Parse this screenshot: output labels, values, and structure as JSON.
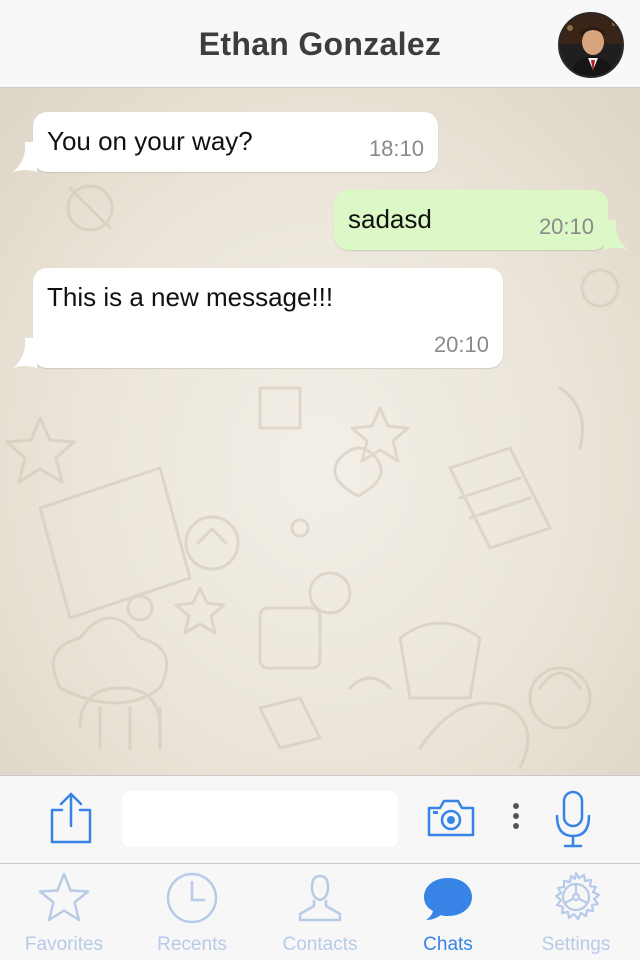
{
  "header": {
    "title": "Ethan Gonzalez"
  },
  "messages": [
    {
      "direction": "incoming",
      "text": "You on your way?",
      "time": "18:10"
    },
    {
      "direction": "outgoing",
      "text": "sadasd",
      "time": "20:10"
    },
    {
      "direction": "incoming",
      "text": "This is a new message!!!",
      "time": "20:10"
    }
  ],
  "composer": {
    "input_value": "",
    "icons": [
      "share-icon",
      "camera-icon",
      "more-vertical-icon",
      "microphone-icon"
    ]
  },
  "tabs": [
    {
      "label": "Favorites",
      "icon": "star-icon",
      "active": false
    },
    {
      "label": "Recents",
      "icon": "clock-icon",
      "active": false
    },
    {
      "label": "Contacts",
      "icon": "person-icon",
      "active": false
    },
    {
      "label": "Chats",
      "icon": "chat-bubble-icon",
      "active": true
    },
    {
      "label": "Settings",
      "icon": "gear-icon",
      "active": false
    }
  ],
  "colors": {
    "accent": "#3784e6",
    "inactive_tab": "#b7cbe8",
    "incoming_bubble": "#ffffff",
    "outgoing_bubble": "#dcf8c6"
  }
}
